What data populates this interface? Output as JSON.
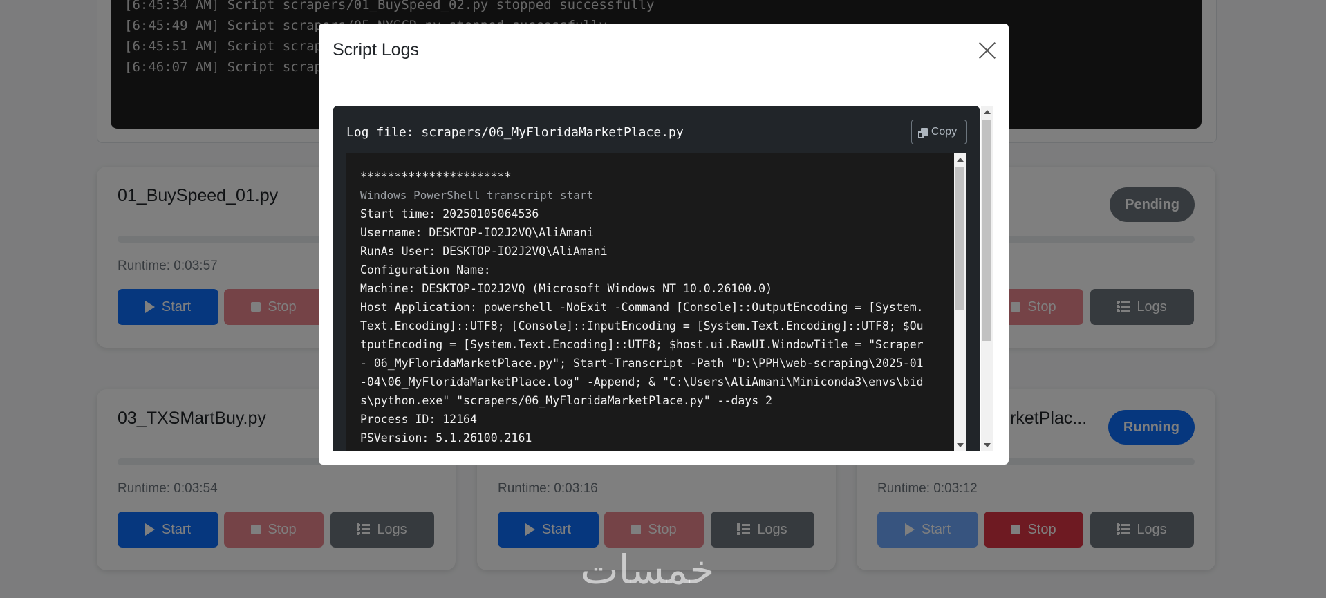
{
  "console": {
    "lines": [
      "[6:45:34 AM] Script scrapers/01_BuySpeed_02.py stopped successfully",
      "[6:45:49 AM] Script scrapers/05_NYSCR.py stopped successfully",
      "[6:45:51 AM] Script scrape",
      "[6:46:07 AM] Script scrape"
    ]
  },
  "cards": [
    {
      "title": "01_BuySpeed_01.py",
      "badge": "",
      "runtime": "Runtime: 0:03:57"
    },
    {
      "title": "",
      "badge": "Pending",
      "runtime": ""
    },
    {
      "title": "03_TXSMartBuy.py",
      "badge": "",
      "runtime": "Runtime: 0:03:54"
    },
    {
      "title": "",
      "badge": "",
      "runtime": "Runtime: 0:03:16"
    },
    {
      "title": "rketPlac...",
      "badge": "Running",
      "runtime": "Runtime: 0:03:12"
    }
  ],
  "buttons": {
    "start": "Start",
    "stop": "Stop",
    "logs": "Logs"
  },
  "watermark": "خمسات",
  "modal": {
    "title": "Script Logs",
    "log_file": "Log file: scrapers/06_MyFloridaMarketPlace.py",
    "copy_label": "Copy",
    "log_lines": [
      "**********************",
      "Windows PowerShell transcript start",
      "Start time: 20250105064536",
      "Username: DESKTOP-IO2J2VQ\\AliAmani",
      "RunAs User: DESKTOP-IO2J2VQ\\AliAmani",
      "Configuration Name:",
      "Machine: DESKTOP-IO2J2VQ (Microsoft Windows NT 10.0.26100.0)",
      "Host Application: powershell -NoExit -Command [Console]::OutputEncoding = [System.Text.Encoding]::UTF8; [Console]::InputEncoding = [System.Text.Encoding]::UTF8; $OutputEncoding = [System.Text.Encoding]::UTF8; $host.ui.RawUI.WindowTitle = \"Scraper - 06_MyFloridaMarketPlace.py\"; Start-Transcript -Path \"D:\\PPH\\web-scraping\\2025-01-04\\06_MyFloridaMarketPlace.log\" -Append; & \"C:\\Users\\AliAmani\\Miniconda3\\envs\\bids\\python.exe\" \"scrapers/06_MyFloridaMarketPlace.py\" --days 2",
      "Process ID: 12164",
      "PSVersion: 5.1.26100.2161"
    ]
  },
  "colors": {
    "primary": "#0d6efd",
    "danger": "#dc3545",
    "secondary": "#6c757d",
    "console_bg": "#1e1e1e",
    "log_bg": "#212529"
  }
}
